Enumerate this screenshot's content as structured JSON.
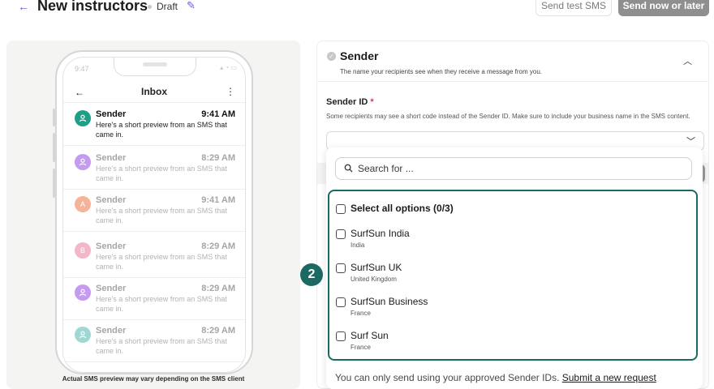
{
  "header": {
    "back_icon": "arrow-left-icon",
    "title": "New instructors",
    "status": "Draft",
    "edit_icon": "pencil-icon",
    "test_button": "Send test SMS",
    "send_button": "Send now or later"
  },
  "preview": {
    "status_time": "9:47",
    "inbox_title": "Inbox",
    "back_icon": "arrow-left-icon",
    "more_icon": "kebab-menu-icon",
    "messages": [
      {
        "sender": "Sender",
        "time": "9:41 AM",
        "body": "Here's a short preview from an SMS that came in.",
        "avatar": "user-icon",
        "color": "#1f9e8a",
        "unread": true
      },
      {
        "sender": "Sender",
        "time": "8:29 AM",
        "body": "Here's a short preview from an SMS that came in.",
        "avatar": "user-icon",
        "color": "#c59bf0",
        "unread": false
      },
      {
        "sender": "Sender",
        "time": "9:41 AM",
        "body": "Here's a short preview from an SMS that came in.",
        "avatar_letter": "A",
        "color": "#f5b399",
        "unread": false
      },
      {
        "sender": "Sender",
        "time": "8:29 AM",
        "body": "Here's a short preview from an SMS that came in.",
        "avatar_letter": "B",
        "color": "#f3b7c7",
        "unread": false
      },
      {
        "sender": "Sender",
        "time": "8:29 AM",
        "body": "Here's a short preview from an SMS that came in.",
        "avatar": "user-icon",
        "color": "#c59bf0",
        "unread": false
      },
      {
        "sender": "Sender",
        "time": "8:29 AM",
        "body": "Here's a short preview from an SMS that came in.",
        "avatar": "user-icon",
        "color": "#9fd8d2",
        "unread": false
      }
    ],
    "note": "Actual SMS preview may vary depending on the SMS client"
  },
  "sender_section": {
    "title": "Sender",
    "subtitle": "The name your recipients see when they receive a message from you.",
    "collapse_icon": "chevron-up-icon",
    "field_label": "Sender ID",
    "required_mark": "*",
    "help": "Some recipients may see a short code instead of the Sender ID. Make sure to include your business name in the SMS content.",
    "select_icon": "chevron-down-icon"
  },
  "dropdown": {
    "search_placeholder": "Search for ...",
    "search_icon": "search-icon",
    "select_all": "Select all options  (0/3)",
    "options": [
      {
        "label": "SurfSun India",
        "sub": "India"
      },
      {
        "label": "SurfSun UK",
        "sub": "United Kingdom"
      },
      {
        "label": "SurfSun Business",
        "sub": "France"
      },
      {
        "label": "Surf Sun",
        "sub": "France"
      }
    ],
    "footer_text": "You can only send using your approved Sender IDs.",
    "footer_link": "Submit a new request"
  },
  "annotation_badge": "2",
  "colors": {
    "accent": "#5b4fd6",
    "highlight": "#1a6a63",
    "required": "#e0344b"
  }
}
